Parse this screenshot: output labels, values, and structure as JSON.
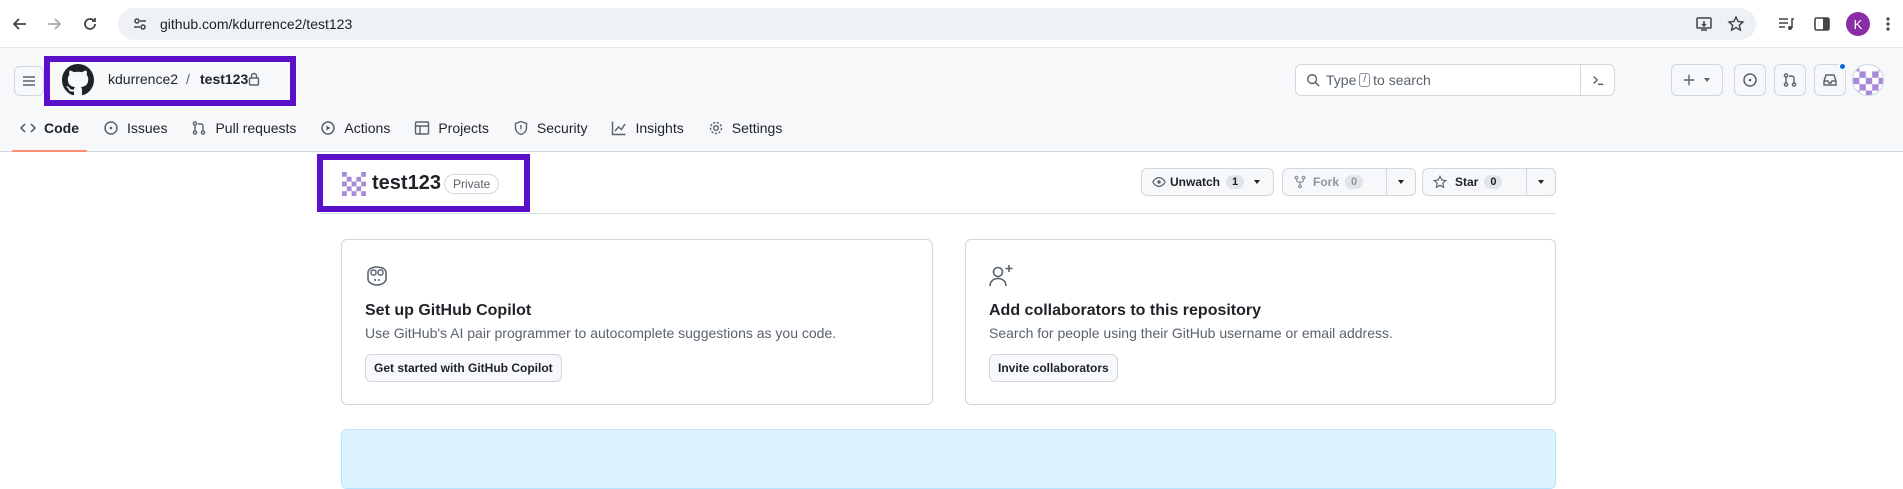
{
  "browser": {
    "url": "github.com/kdurrence2/test123",
    "profile_initial": "K"
  },
  "header": {
    "owner": "kdurrence2",
    "separator": "/",
    "repo": "test123",
    "search_prefix": "Type",
    "search_key": "/",
    "search_suffix": "to search"
  },
  "tabs": [
    {
      "label": "Code",
      "icon": "code-icon"
    },
    {
      "label": "Issues",
      "icon": "issue-opened-icon"
    },
    {
      "label": "Pull requests",
      "icon": "git-pull-request-icon"
    },
    {
      "label": "Actions",
      "icon": "play-icon"
    },
    {
      "label": "Projects",
      "icon": "table-icon"
    },
    {
      "label": "Security",
      "icon": "shield-icon"
    },
    {
      "label": "Insights",
      "icon": "graph-icon"
    },
    {
      "label": "Settings",
      "icon": "gear-icon"
    }
  ],
  "repo_head": {
    "name": "test123",
    "visibility": "Private",
    "watch_label": "Unwatch",
    "watch_count": "1",
    "fork_label": "Fork",
    "fork_count": "0",
    "star_label": "Star",
    "star_count": "0"
  },
  "cards": [
    {
      "title": "Set up GitHub Copilot",
      "desc": "Use GitHub's AI pair programmer to autocomplete suggestions as you code.",
      "button": "Get started with GitHub Copilot",
      "icon": "copilot-icon"
    },
    {
      "title": "Add collaborators to this repository",
      "desc": "Search for people using their GitHub username or email address.",
      "button": "Invite collaborators",
      "icon": "person-add-icon"
    }
  ],
  "colors": {
    "highlight": "#5a0fc8",
    "active_tab_underline": "#fd8c73",
    "quick_setup_bg": "#ddf4ff"
  }
}
